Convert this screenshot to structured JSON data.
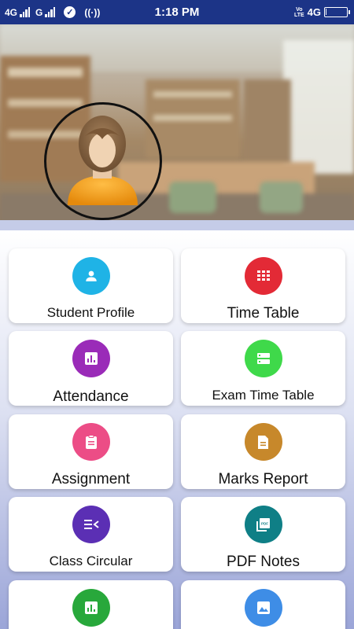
{
  "status_bar": {
    "network_left_1": "4G",
    "network_left_2": "G",
    "time": "1:18 PM",
    "volte_top": "Vo",
    "volte_bottom": "LTE",
    "network_right": "4G",
    "battery_level": 0.05
  },
  "header": {
    "avatar_alt": "student avatar"
  },
  "menu": [
    {
      "label": "Student Profile",
      "icon": "person-icon",
      "color": "#1fb3e6"
    },
    {
      "label": "Time Table",
      "icon": "grid-icon",
      "color": "#e32a36"
    },
    {
      "label": "Attendance",
      "icon": "chart-icon",
      "color": "#9a2bb8"
    },
    {
      "label": "Exam Time Table",
      "icon": "list-icon",
      "color": "#3fd94a"
    },
    {
      "label": "Assignment",
      "icon": "clipboard-icon",
      "color": "#ec4d86"
    },
    {
      "label": "Marks Report",
      "icon": "document-icon",
      "color": "#c7882b"
    },
    {
      "label": "Class Circular",
      "icon": "feed-icon",
      "color": "#5b2fb4"
    },
    {
      "label": "PDF Notes",
      "icon": "pdf-icon",
      "color": "#0f7f86"
    },
    {
      "label": "",
      "icon": "chart-icon",
      "color": "#28a83b"
    },
    {
      "label": "",
      "icon": "image-icon",
      "color": "#3e8de6"
    }
  ]
}
